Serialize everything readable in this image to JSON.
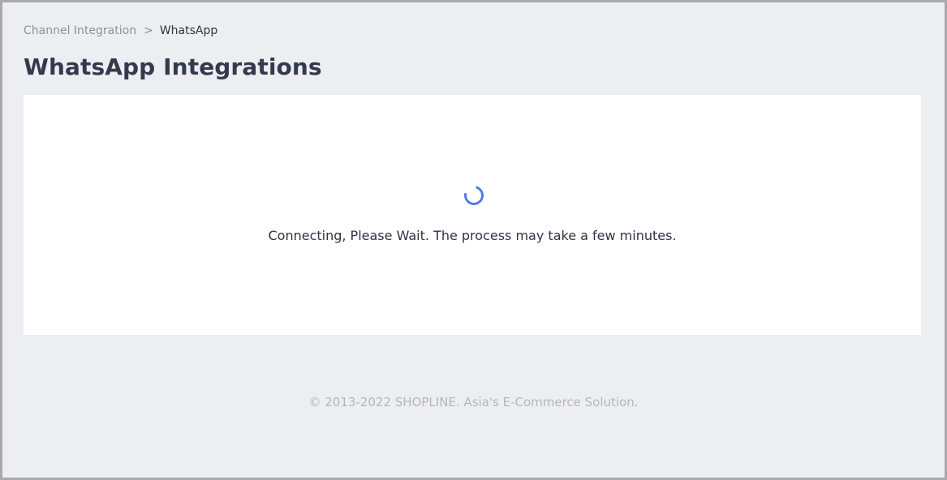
{
  "breadcrumb": {
    "parent": "Channel Integration",
    "separator": ">",
    "current": "WhatsApp"
  },
  "page": {
    "title": "WhatsApp Integrations"
  },
  "loading": {
    "icon": "spinner-icon",
    "message": "Connecting, Please Wait. The process may take a few minutes.",
    "accent_color": "#4f7cec"
  },
  "footer": {
    "copyright": "© 2013-2022 SHOPLINE. Asia's E-Commerce Solution."
  }
}
